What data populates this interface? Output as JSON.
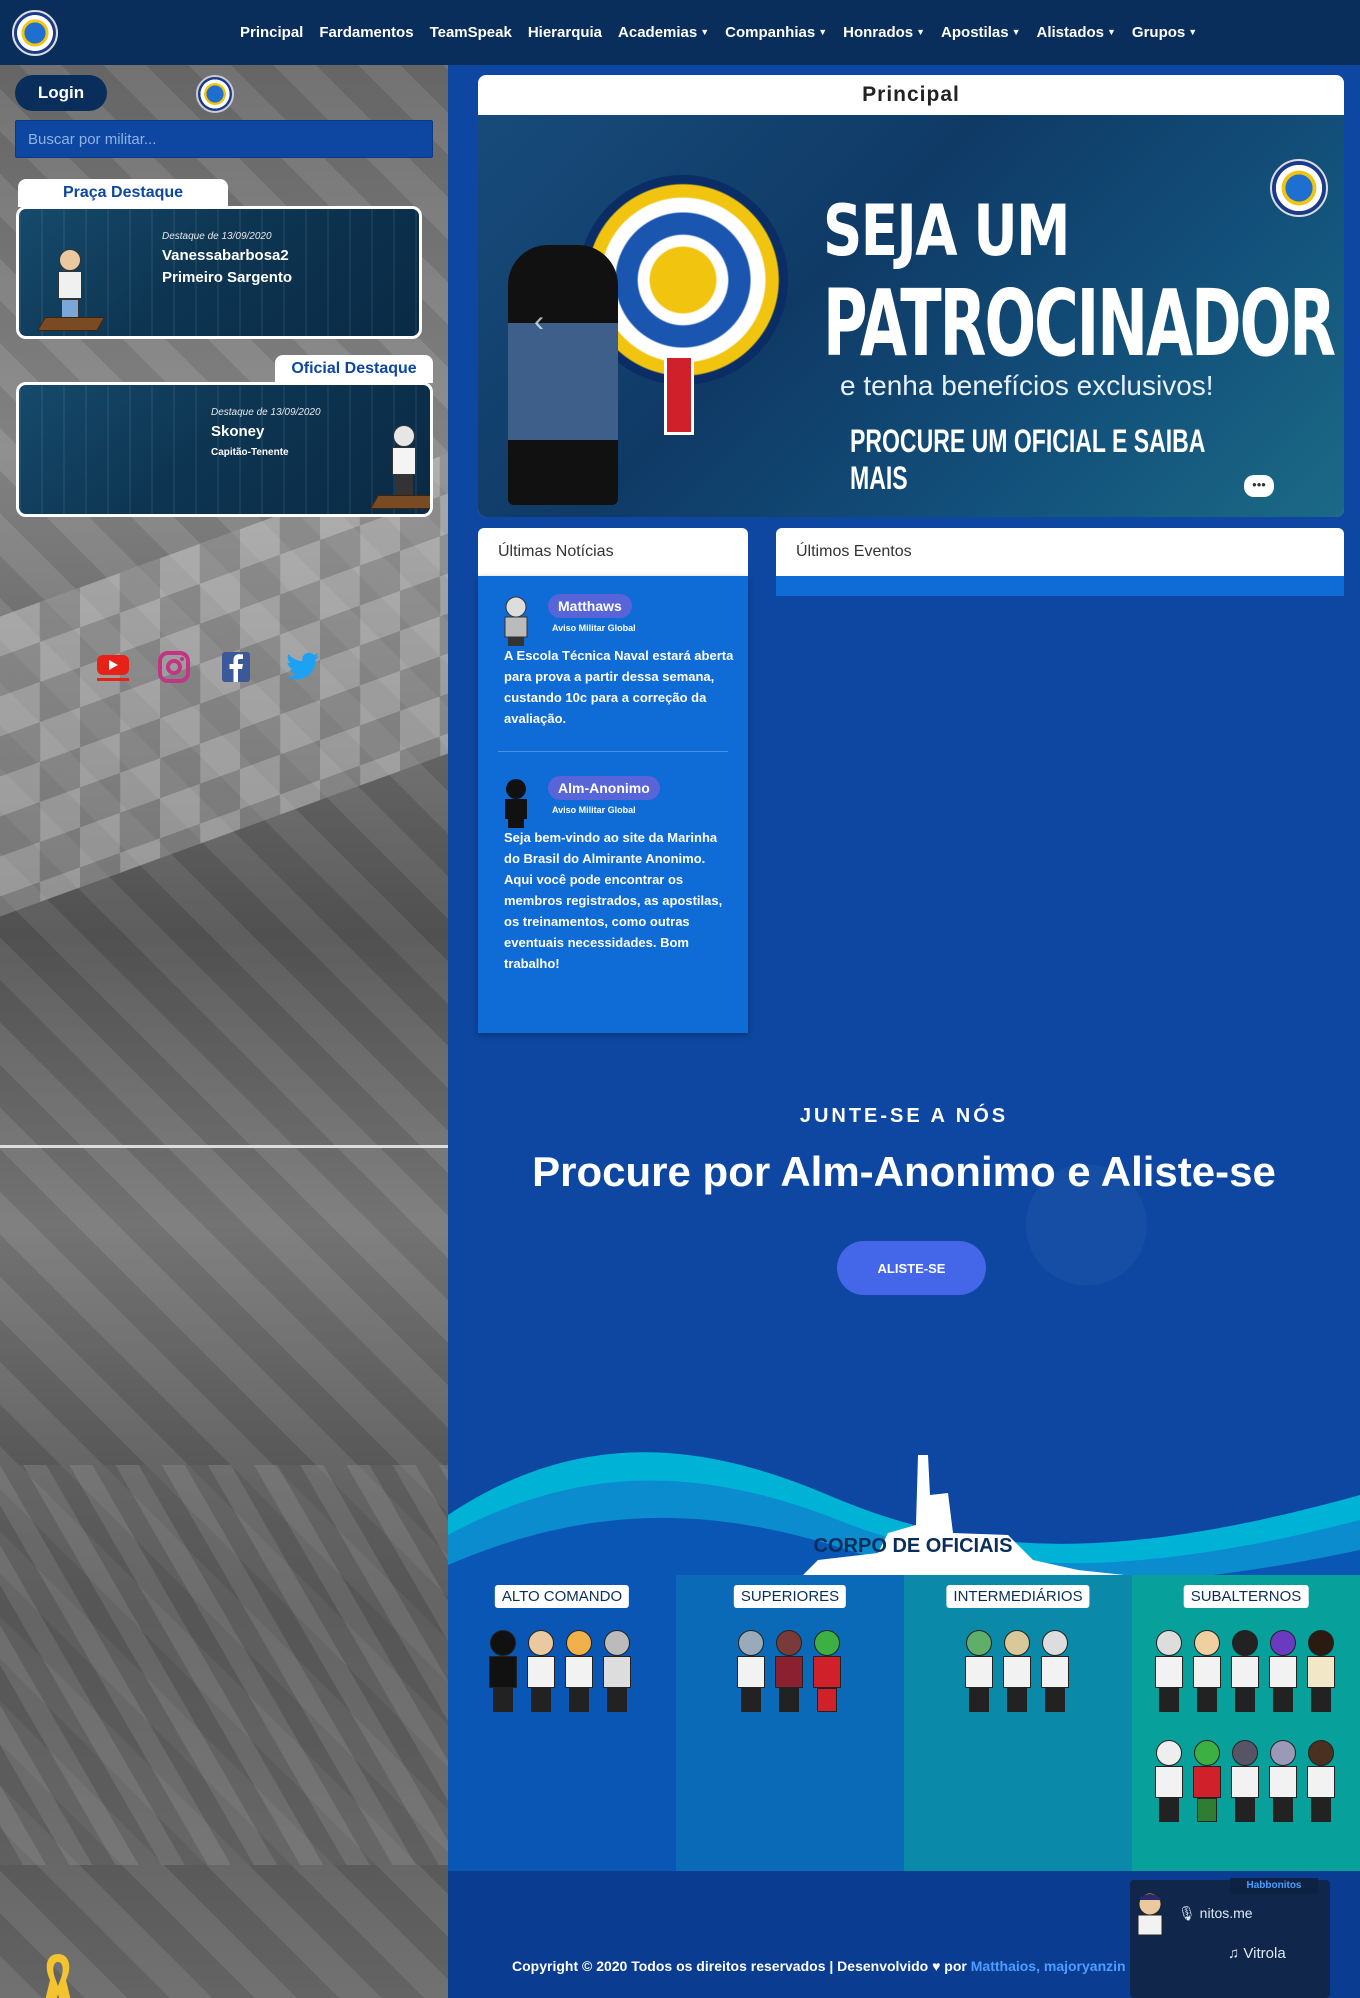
{
  "nav": {
    "items": [
      {
        "label": "Principal",
        "dropdown": false
      },
      {
        "label": "Fardamentos",
        "dropdown": false
      },
      {
        "label": "TeamSpeak",
        "dropdown": false
      },
      {
        "label": "Hierarquia",
        "dropdown": false
      },
      {
        "label": "Academias",
        "dropdown": true
      },
      {
        "label": "Companhias",
        "dropdown": true
      },
      {
        "label": "Honrados",
        "dropdown": true
      },
      {
        "label": "Apostilas",
        "dropdown": true
      },
      {
        "label": "Alistados",
        "dropdown": true
      },
      {
        "label": "Grupos",
        "dropdown": true
      }
    ]
  },
  "sidebar": {
    "login_label": "Login",
    "search_placeholder": "Buscar por militar...",
    "praca": {
      "tab": "Praça Destaque",
      "date": "Destaque de 13/09/2020",
      "name": "Vanessabarbosa2",
      "rank": "Primeiro Sargento"
    },
    "oficial": {
      "tab": "Oficial Destaque",
      "date": "Destaque de 13/09/2020",
      "name": "Skoney",
      "rank": "Capitão-Tenente"
    },
    "social": [
      {
        "icon": "youtube-icon",
        "color": "#e62117"
      },
      {
        "icon": "instagram-icon",
        "color": "#c13584"
      },
      {
        "icon": "facebook-icon",
        "color": "#3b5998"
      },
      {
        "icon": "twitter-icon",
        "color": "#1da1f2"
      }
    ]
  },
  "main": {
    "principal_title": "Principal",
    "banner": {
      "line1": "SEJA UM",
      "line2": "PATROCINADOR",
      "line3": "e tenha benefícios exclusivos!",
      "line4": "PROCURE UM OFICIAL E SAIBA MAIS"
    },
    "news": {
      "header": "Últimas Notícias",
      "items": [
        {
          "author": "Matthaws",
          "role": "Aviso Militar Global",
          "text": "A Escola Técnica Naval estará aberta para prova a partir dessa semana, custando 10c para a correção da avaliação."
        },
        {
          "author": "Alm-Anonimo",
          "role": "Aviso Militar Global",
          "text": "Seja bem-vindo ao site da Marinha do Brasil do Almirante Anonimo. Aqui você pode encontrar os membros registrados, as apostilas, os treinamentos, como outras eventuais necessidades. Bom trabalho!"
        }
      ]
    },
    "events": {
      "header": "Últimos Eventos"
    },
    "join": {
      "kicker": "JUNTE-SE A NÓS",
      "title": "Procure por Alm-Anonimo e Aliste-se",
      "button": "ALISTE-SE"
    },
    "officers": {
      "title": "CORPO DE OFICIAIS",
      "columns": [
        {
          "label": "ALTO COMANDO",
          "bg": "#0a56b5"
        },
        {
          "label": "SUPERIORES",
          "bg": "#0a6ab8"
        },
        {
          "label": "INTERMEDIÁRIOS",
          "bg": "#0a8aa8"
        },
        {
          "label": "SUBALTERNOS",
          "bg": "#08a09a"
        }
      ]
    },
    "footer": {
      "copyright": "Copyright © 2020 Todos os direitos reservados | Desenvolvido",
      "by": "por",
      "authors": "Matthaios, majoryanzin"
    }
  },
  "music_widget": {
    "tab": "Habbonitos",
    "site": "nitos.me",
    "player": "Vitrola"
  },
  "colors": {
    "navbar": "#0a2e5c",
    "main_bg": "#0d47a1",
    "news_bg": "#0f6bd6",
    "button": "#4466e8"
  }
}
